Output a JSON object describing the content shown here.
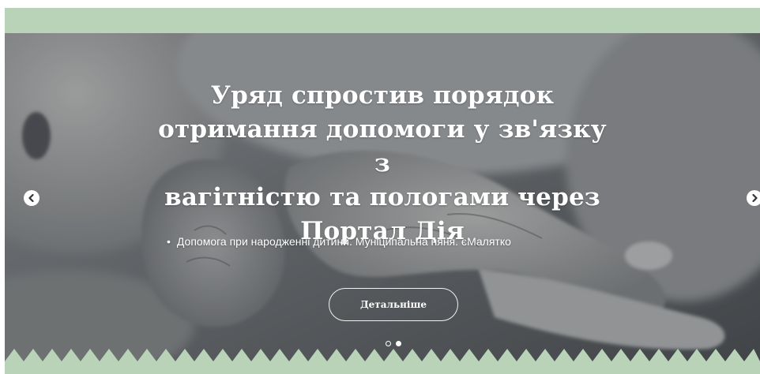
{
  "slider": {
    "title": "Уряд спростив порядок отримання допомоги у зв'язку з вагітністю та пологами через Портал Дія",
    "title_lines": [
      "Уряд спростив порядок",
      "отримання допомоги у зв'язку з",
      "вагітністю та пологами через",
      "Портал Дія"
    ],
    "bullet": "•",
    "tags": "Допомога при народженні дитини. Муніципальна няня. єМалятко",
    "button_label": "Детальніше",
    "prev_icon": "chevron-left-icon",
    "next_icon": "chevron-right-icon",
    "dots": [
      {
        "state": "inactive"
      },
      {
        "state": "active"
      }
    ]
  },
  "colors": {
    "accent_green": "#b9d3b8",
    "overlay_text": "#ffffff"
  }
}
